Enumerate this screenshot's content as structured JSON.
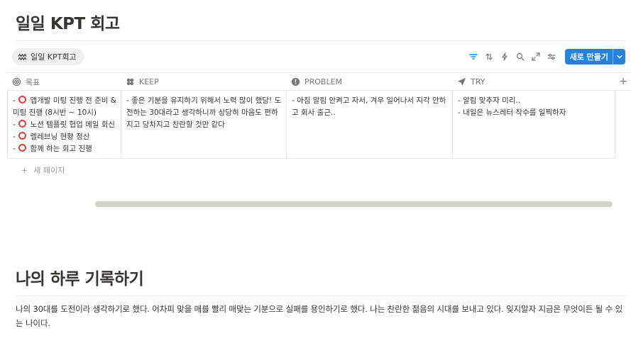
{
  "page_title": "일일 KPT 회고",
  "view_tab": {
    "label": "일일 KPT회고",
    "icon": "kpt-wave-icon"
  },
  "toolbar": {
    "icons": [
      "filter-icon",
      "sort-icon",
      "automation-icon",
      "search-icon",
      "expand-icon",
      "settings-icon"
    ],
    "new_button_label": "새로 만들기"
  },
  "columns": [
    {
      "name": "목표",
      "icon": "target-icon"
    },
    {
      "name": "KEEP",
      "icon": "clover-icon"
    },
    {
      "name": "PROBLEM",
      "icon": "alert-icon"
    },
    {
      "name": "TRY",
      "icon": "send-icon"
    }
  ],
  "row": {
    "goal": [
      {
        "prefix": "- ",
        "check": true,
        "text": " 앱개발 미팅 진행 전 준비 &"
      },
      {
        "prefix": "",
        "check": false,
        "text": "미팅 진행 (8시반 ~ 10시)"
      },
      {
        "prefix": "- ",
        "check": true,
        "text": " 노션 템플릿 협업 메일 회신"
      },
      {
        "prefix": "- ",
        "check": true,
        "text": " 렐레브닝 현황 정산"
      },
      {
        "prefix": "- ",
        "check": true,
        "text": " 함께 하는 회고 진행"
      }
    ],
    "keep": [
      "- 좋은 기분을 유지하기 위해서 노력 많이 했당! 도",
      "전하는 30대라고 생각하니까 상당히 마음도 편하",
      "지고 당차지고 찬란할 것만 같다"
    ],
    "problem": [
      "- 아침 알림 안켜고 자서, 겨우 일어나서 지각 안하",
      "고 회사 출근.."
    ],
    "try": [
      "- 알림 맞추자 미리..",
      "- 내일은 뉴스레터 착수를 일찍하자"
    ]
  },
  "new_page_label": "새 페이지",
  "section2": {
    "title": "나의 하루 기록하기",
    "paragraph": "나의 30대를 도전이라 생각하기로 했다. 어차피 맞을 매를 빨리 매맞는 기분으로 실패를 용인하기로 했다. 나는 찬란한 젊음의 시대를 보내고 있다. 잊지말자 지금은 무엇이든 될 수 있는 나이다."
  },
  "colors": {
    "accent": "#2383e2",
    "check_circle": "#e03e3e",
    "text": "#37352f",
    "muted": "#787774"
  }
}
